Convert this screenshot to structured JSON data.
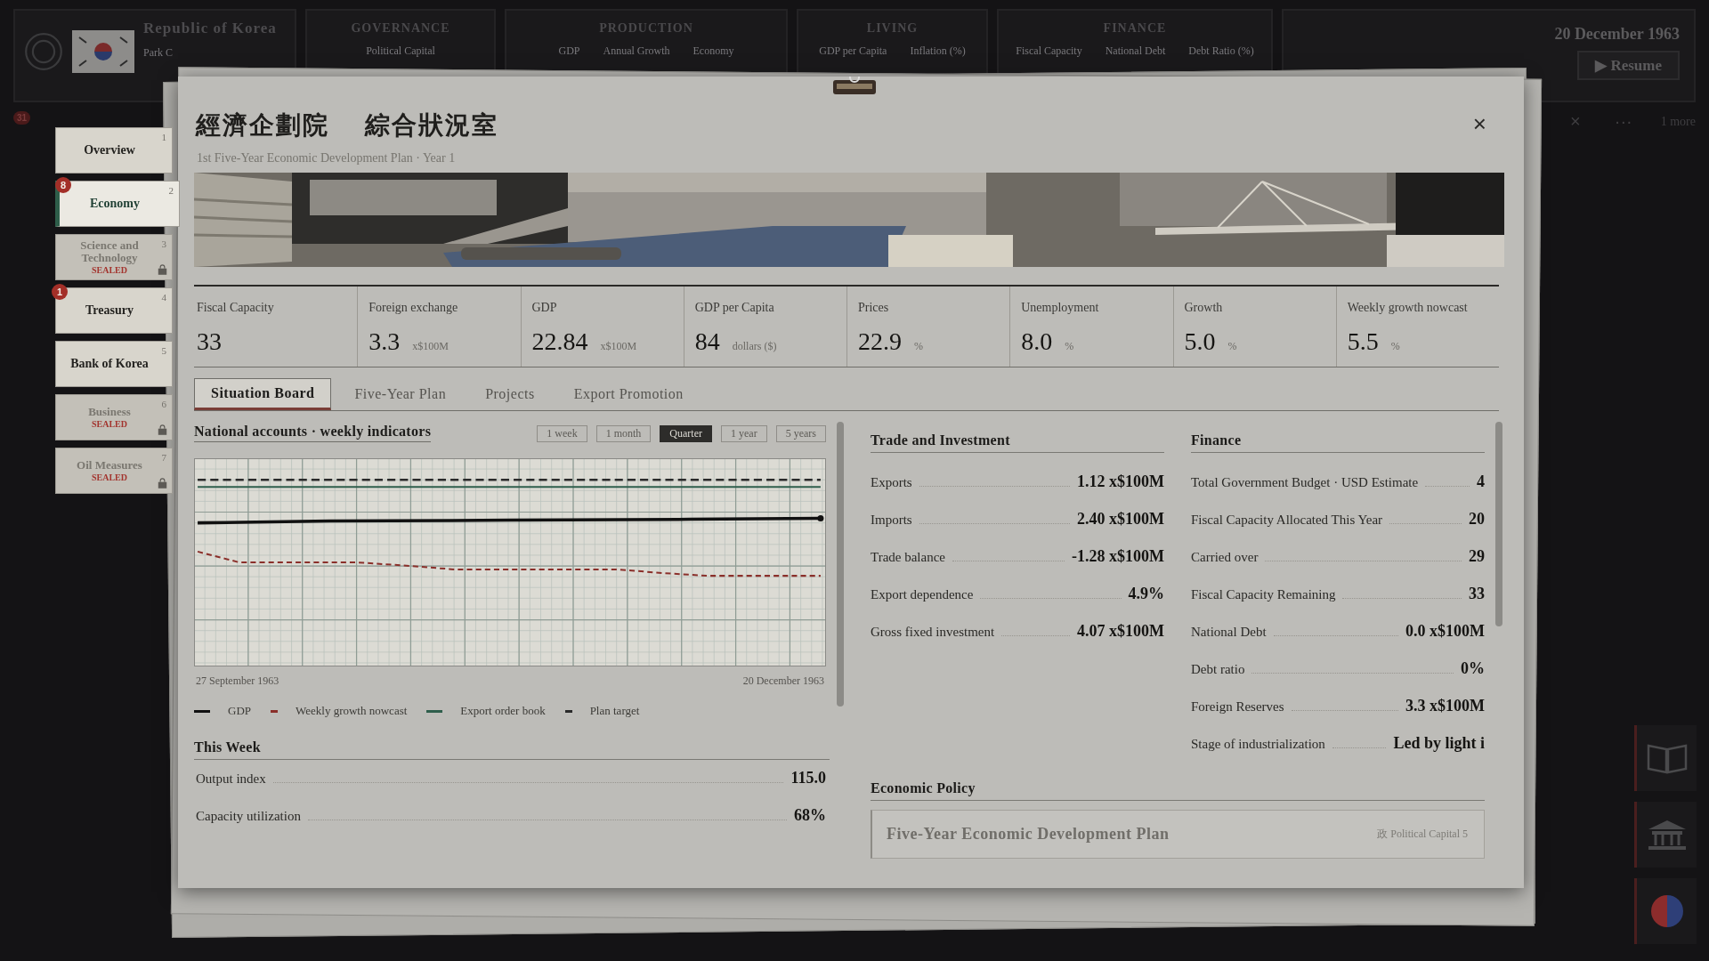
{
  "top_bar": {
    "country": "Republic of Korea",
    "leader": "Park C",
    "sections": [
      {
        "title": "GOVERNANCE",
        "labels": [
          "Political Capital"
        ]
      },
      {
        "title": "PRODUCTION",
        "labels": [
          "GDP",
          "Annual Growth",
          "Economy"
        ]
      },
      {
        "title": "LIVING",
        "labels": [
          "GDP per Capita",
          "Inflation (%)"
        ]
      },
      {
        "title": "FINANCE",
        "labels": [
          "Fiscal Capacity",
          "National Debt",
          "Debt Ratio (%)"
        ]
      }
    ],
    "date": "20 December 1963",
    "resume_icon": "▶",
    "resume": "Resume"
  },
  "alerts": {
    "count": "31",
    "close": "×",
    "more_icon": "···",
    "more": "1 more"
  },
  "sidebar": {
    "items": [
      {
        "label": "Overview",
        "key": "1",
        "selected": false,
        "locked": false
      },
      {
        "label": "Economy",
        "key": "2",
        "selected": true,
        "locked": false,
        "badge": "8"
      },
      {
        "label": "Science and Technology",
        "key": "3",
        "selected": false,
        "locked": true,
        "seal": "SEALED"
      },
      {
        "label": "Treasury",
        "key": "4",
        "selected": false,
        "locked": false,
        "badge": "1"
      },
      {
        "label": "Bank of Korea",
        "key": "5",
        "selected": false,
        "locked": false
      },
      {
        "label": "Business",
        "key": "6",
        "selected": false,
        "locked": true,
        "seal": "SEALED"
      },
      {
        "label": "Oil Measures",
        "key": "7",
        "selected": false,
        "locked": true,
        "seal": "SEALED"
      }
    ]
  },
  "dialog": {
    "title_parts": [
      "經濟企劃院",
      "綜合狀況室"
    ],
    "subtitle": "1st Five-Year Economic Development Plan · Year 1",
    "close": "×",
    "stats": [
      {
        "label": "Fiscal Capacity",
        "value": "33"
      },
      {
        "label": "Foreign exchange",
        "value": "3.3",
        "unit": "x$100M"
      },
      {
        "label": "GDP",
        "value": "22.84",
        "unit": "x$100M"
      },
      {
        "label": "GDP per Capita",
        "value": "84",
        "unit": "dollars ($)"
      },
      {
        "label": "Prices",
        "value": "22.9",
        "unit": "%"
      },
      {
        "label": "Unemployment",
        "value": "8.0",
        "unit": "%"
      },
      {
        "label": "Growth",
        "value": "5.0",
        "unit": "%"
      },
      {
        "label": "Weekly growth nowcast",
        "value": "5.5",
        "unit": "%"
      }
    ],
    "tabs": [
      {
        "label": "Situation Board",
        "selected": true
      },
      {
        "label": "Five-Year Plan",
        "selected": false
      },
      {
        "label": "Projects",
        "selected": false
      },
      {
        "label": "Export Promotion",
        "selected": false
      }
    ],
    "chart_panel": {
      "title": "National accounts · weekly indicators",
      "ranges": [
        {
          "label": "1 week",
          "selected": false
        },
        {
          "label": "1 month",
          "selected": false
        },
        {
          "label": "Quarter",
          "selected": true
        },
        {
          "label": "1 year",
          "selected": false
        },
        {
          "label": "5 years",
          "selected": false
        }
      ],
      "start_date": "27 September 1963",
      "end_date": "20 December 1963",
      "legend": [
        {
          "label": "GDP",
          "color": "#111111",
          "kind": "solid"
        },
        {
          "label": "Weekly growth nowcast",
          "color": "#8a2f2a",
          "kind": "dashed"
        },
        {
          "label": "Export order book",
          "color": "#2f5e4c",
          "kind": "solid"
        },
        {
          "label": "Plan target",
          "color": "#2a2a2a",
          "kind": "dashed"
        }
      ]
    },
    "this_week": {
      "title": "This Week",
      "rows": [
        {
          "label": "Output index",
          "value": "115.0"
        },
        {
          "label": "Capacity utilization",
          "value": "68%"
        }
      ]
    },
    "trade": {
      "title": "Trade and Investment",
      "rows": [
        {
          "label": "Exports",
          "value": "1.12 x$100M"
        },
        {
          "label": "Imports",
          "value": "2.40 x$100M"
        },
        {
          "label": "Trade balance",
          "value": "-1.28 x$100M"
        },
        {
          "label": "Export dependence",
          "value": "4.9%"
        },
        {
          "label": "Gross fixed investment",
          "value": "4.07 x$100M"
        }
      ]
    },
    "finance": {
      "title": "Finance",
      "rows": [
        {
          "label": "Total Government Budget · USD Estimate",
          "value": "4"
        },
        {
          "label": "Fiscal Capacity Allocated This Year",
          "value": "20"
        },
        {
          "label": "Carried over",
          "value": "29"
        },
        {
          "label": "Fiscal Capacity Remaining",
          "value": "33"
        },
        {
          "label": "National Debt",
          "value": "0.0 x$100M"
        },
        {
          "label": "Debt ratio",
          "value": "0%"
        },
        {
          "label": "Foreign Reserves",
          "value": "3.3 x$100M"
        },
        {
          "label": "Stage of industrialization",
          "value": "Led by light i"
        }
      ]
    },
    "policy": {
      "title": "Economic Policy",
      "items": [
        {
          "name": "Five-Year Economic Development Plan",
          "cost_icon": "政",
          "cost": "Political Capital 5"
        }
      ]
    }
  }
}
